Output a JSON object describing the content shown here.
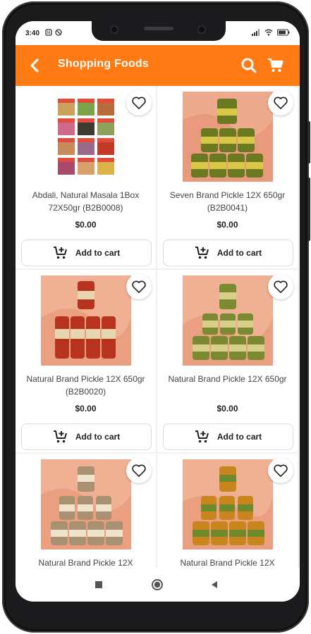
{
  "status_bar": {
    "time": "3:40"
  },
  "app_bar": {
    "title": "Shopping Foods"
  },
  "products": [
    {
      "name": "Abdali, Natural Masala 1Box 72X50gr (B2B0008)",
      "price": "$0.00",
      "cta": "Add to cart",
      "image": "masala-packets"
    },
    {
      "name": "Seven Brand  Pickle 12X 650gr (B2B0041)",
      "price": "$0.00",
      "cta": "Add to cart",
      "image": "green-pickle-jars"
    },
    {
      "name": "Natural Brand  Pickle 12X 650gr (B2B0020)",
      "price": "$0.00",
      "cta": "Add to cart",
      "image": "red-pickle-jars"
    },
    {
      "name": "Natural Brand  Pickle 12X 650gr",
      "price": "$0.00",
      "cta": "Add to cart",
      "image": "green-pickle-jars"
    },
    {
      "name": "Natural Brand  Pickle 12X",
      "price": "",
      "cta": "",
      "image": "cream-pickle-jars"
    },
    {
      "name": "Natural Brand  Pickle 12X",
      "price": "",
      "cta": "",
      "image": "orange-pickle-jars"
    }
  ],
  "colors": {
    "accent": "#ff7a12",
    "grid_bg": "#f1f1f1"
  }
}
